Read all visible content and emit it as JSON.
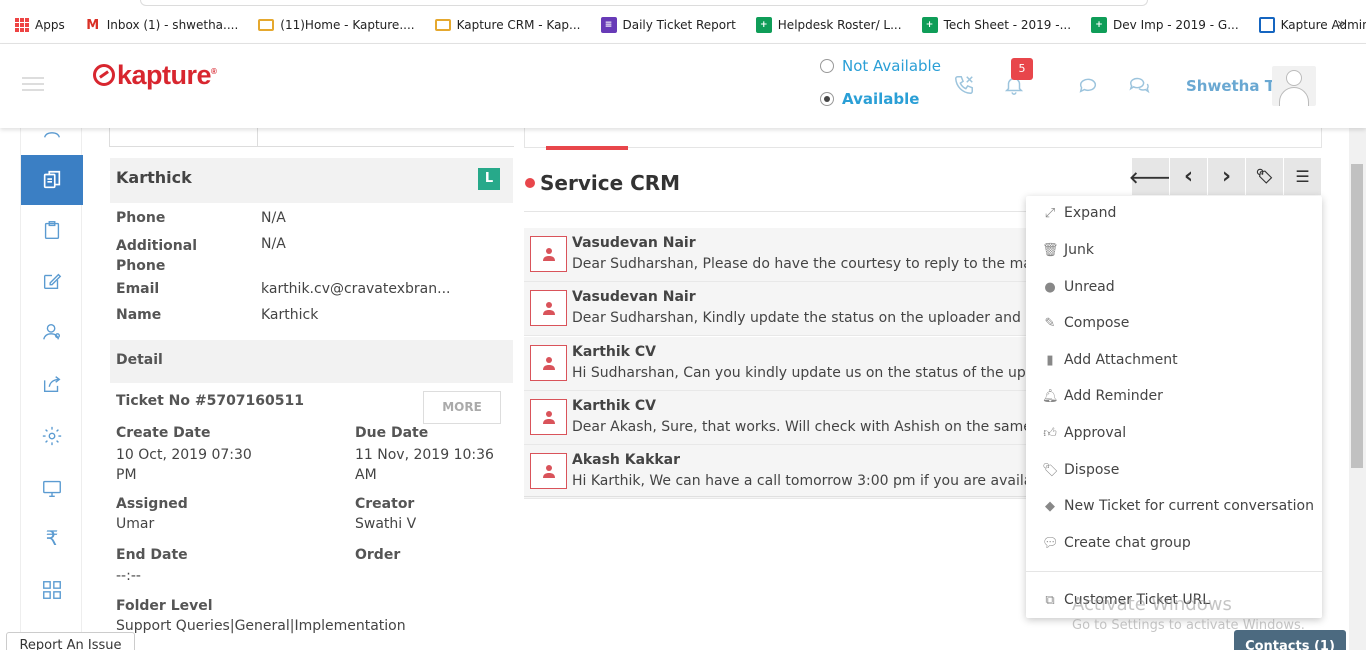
{
  "bookmarks": [
    {
      "label": "Apps",
      "icon": "apps-grid-icon"
    },
    {
      "label": "Inbox (1) - shwetha....",
      "icon": "gmail-icon"
    },
    {
      "label": "(11)Home - Kapture....",
      "icon": "kapture-icon"
    },
    {
      "label": "Kapture CRM - Kap...",
      "icon": "kapture-icon"
    },
    {
      "label": "Daily Ticket Report",
      "icon": "forms-icon"
    },
    {
      "label": "Helpdesk Roster/ L...",
      "icon": "sheets-icon"
    },
    {
      "label": "Tech Sheet - 2019 -...",
      "icon": "sheets-icon"
    },
    {
      "label": "Dev Imp - 2019 - G...",
      "icon": "sheets-icon"
    },
    {
      "label": "Kapture Admin",
      "icon": "admin-icon"
    }
  ],
  "bookmarks_more": "»",
  "header": {
    "logo": "kapture",
    "status_not_available": "Not Available",
    "status_available": "Available",
    "notification_count": "5",
    "user_name": "Shwetha T"
  },
  "sidebar": {
    "items": [
      {
        "icon": "contacts-icon"
      },
      {
        "icon": "tickets-icon",
        "active": true
      },
      {
        "icon": "clipboard-icon"
      },
      {
        "icon": "edit-icon"
      },
      {
        "icon": "users-icon"
      },
      {
        "icon": "share-icon"
      },
      {
        "icon": "gear-icon"
      },
      {
        "icon": "monitor-icon"
      },
      {
        "icon": "rupee-icon"
      },
      {
        "icon": "grid-icon"
      }
    ]
  },
  "customer": {
    "name": "Karthick",
    "badge": "L",
    "fields": [
      {
        "label": "Phone",
        "value": "N/A"
      },
      {
        "label": "Additional Phone",
        "value": "N/A"
      },
      {
        "label": "Email",
        "value": "karthik.cv@cravatexbran..."
      },
      {
        "label": "Name",
        "value": "Karthick"
      }
    ]
  },
  "detail": {
    "heading": "Detail",
    "ticket_no": "Ticket No #5707160511",
    "more_label": "MORE",
    "create_date_label": "Create Date",
    "create_date_value": "10 Oct, 2019 07:30 PM",
    "due_date_label": "Due Date",
    "due_date_value": "11 Nov, 2019 10:36 AM",
    "assigned_label": "Assigned",
    "assigned_value": "Umar",
    "creator_label": "Creator",
    "creator_value": "Swathi V",
    "end_date_label": "End Date",
    "end_date_value": "--:--",
    "order_label": "Order",
    "folder_label": "Folder Level",
    "folder_value": "Support Queries|General|Implementation"
  },
  "conversation": {
    "title": "Service CRM",
    "messages": [
      {
        "from": "Vasudevan Nair",
        "text": "Dear Sudharshan, Please do have the courtesy to reply to the mails,"
      },
      {
        "from": "Vasudevan Nair",
        "text": "Dear Sudharshan,  Kindly update the status on the uploader and also"
      },
      {
        "from": "Karthik CV",
        "text": "Hi Sudharshan, Can you kindly update us on the status of the upload"
      },
      {
        "from": "Karthik CV",
        "text": "Dear Akash, Sure, that works. Will check with Ashish on the same. Wi"
      },
      {
        "from": "Akash Kakkar",
        "text": "Hi Karthik, We can have a call tomorrow 3:00 pm if you are available."
      }
    ]
  },
  "nav_buttons": [
    {
      "icon": "arrow-left-icon",
      "glyph": "🡐"
    },
    {
      "icon": "chevron-left-icon",
      "glyph": "‹"
    },
    {
      "icon": "chevron-right-icon",
      "glyph": "›"
    },
    {
      "icon": "tags-icon",
      "glyph": "🏷"
    },
    {
      "icon": "menu-icon",
      "glyph": "☰"
    }
  ],
  "menu": {
    "items": [
      {
        "label": "Expand",
        "icon": "expand-icon"
      },
      {
        "label": "Junk",
        "icon": "trash-icon"
      },
      {
        "label": "Unread",
        "icon": "circle-icon"
      },
      {
        "label": "Compose",
        "icon": "compose-icon"
      },
      {
        "label": "Add Attachment",
        "icon": "file-icon"
      },
      {
        "label": "Add Reminder",
        "icon": "bell-icon"
      },
      {
        "label": "Approval",
        "icon": "thumbs-up-icon"
      },
      {
        "label": "Dispose",
        "icon": "tags-icon"
      },
      {
        "label": "New Ticket for current conversation",
        "icon": "ticket-icon"
      },
      {
        "label": "Create chat group",
        "icon": "chat-icon"
      }
    ],
    "footer_item": {
      "label": "Customer Ticket URL",
      "icon": "external-link-icon"
    }
  },
  "watermark": {
    "line1": "Activate Windows",
    "line2": "Go to Settings to activate Windows."
  },
  "footer": {
    "report_issue": "Report An Issue",
    "contacts": "Contacts (1)"
  }
}
